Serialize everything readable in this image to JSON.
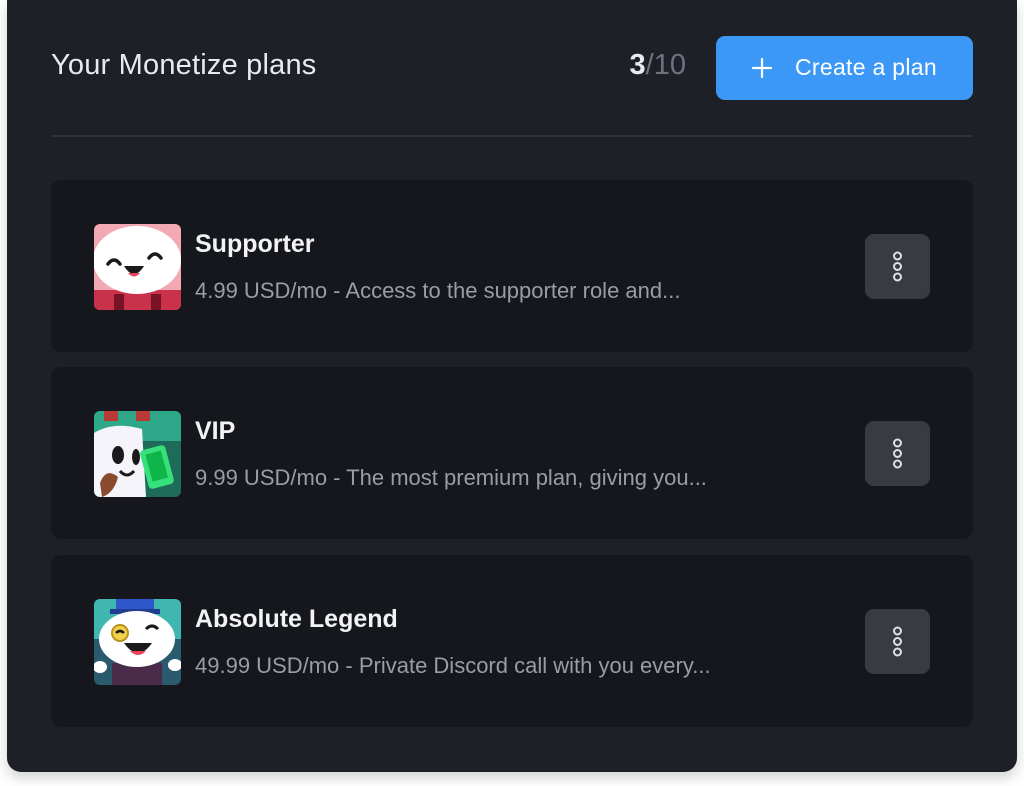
{
  "header": {
    "title": "Your Monetize plans",
    "count_current": "3",
    "count_max": "/10",
    "create_label": "Create a plan"
  },
  "colors": {
    "accent": "#3b98f7",
    "panel": "#1e2027",
    "card": "#16171c"
  },
  "plans": [
    {
      "name": "Supporter",
      "description": "4.99 USD/mo - Access to the supporter role and...",
      "thumbnail_icon": "happy-character-avatar"
    },
    {
      "name": "VIP",
      "description": "9.99 USD/mo - The most premium plan, giving you...",
      "thumbnail_icon": "character-with-phone-avatar"
    },
    {
      "name": "Absolute Legend",
      "description": "49.99 USD/mo - Private Discord call with you every...",
      "thumbnail_icon": "top-hat-monocle-character-avatar"
    }
  ],
  "icons": {
    "create": "plus-icon",
    "more": "more-vertical-icon"
  }
}
